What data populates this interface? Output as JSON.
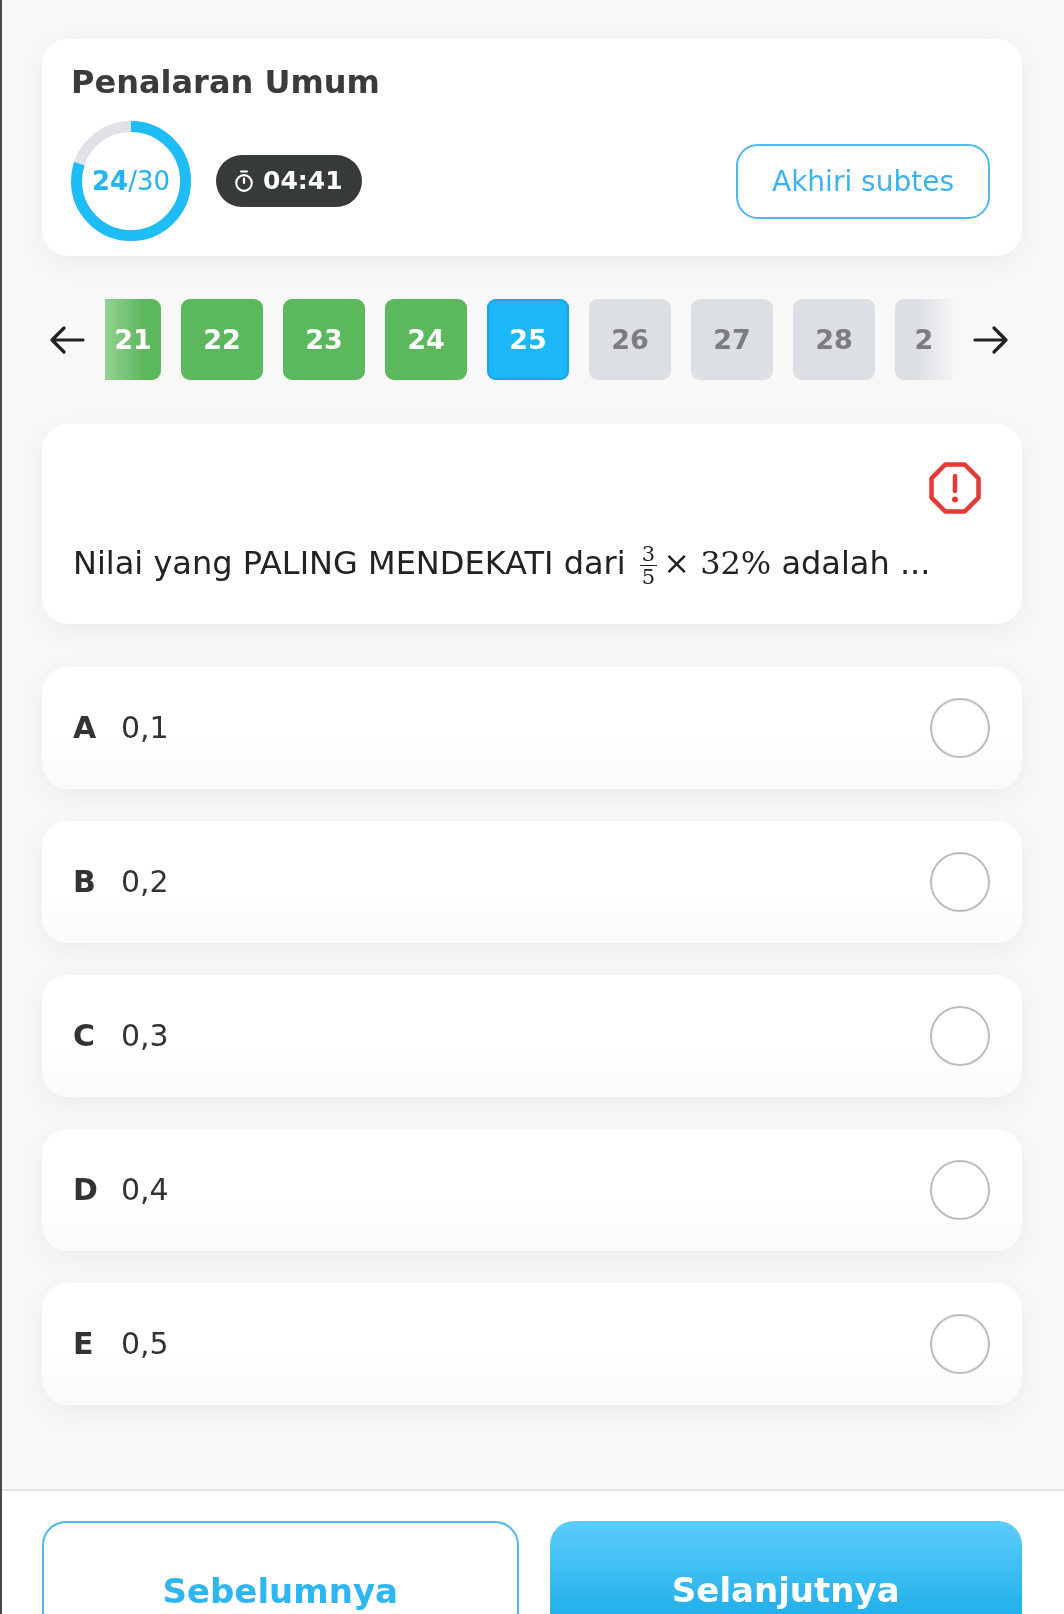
{
  "header": {
    "title": "Penalaran Umum",
    "progress": {
      "label": "**24**/30",
      "level": 0.8
    },
    "timer": "04:41",
    "end_button": "Akhiri subtes"
  },
  "question_nav": [
    {
      "label": "21",
      "answered": true,
      "selected": false
    },
    {
      "label": "22",
      "answered": true,
      "selected": false
    },
    {
      "label": "23",
      "answered": true,
      "selected": false
    },
    {
      "label": "24",
      "answered": true,
      "selected": false
    },
    {
      "label": "25",
      "answered": false,
      "selected": true
    },
    {
      "label": "26",
      "answered": false,
      "selected": false
    },
    {
      "label": "27",
      "answered": false,
      "selected": false
    },
    {
      "label": "28",
      "answered": false,
      "selected": false
    },
    {
      "label": "2",
      "answered": false,
      "selected": false
    }
  ],
  "question": {
    "text_before": "Nilai yang PALING MENDEKATI dari",
    "fraction": {
      "numerator": "3",
      "denominator": "5"
    },
    "expression": "× 32%",
    "text_after": "adalah ..."
  },
  "options": [
    {
      "letter": "A",
      "text": "0,1",
      "selected": false
    },
    {
      "letter": "B",
      "text": "0,2",
      "selected": false
    },
    {
      "letter": "C",
      "text": "0,3",
      "selected": false
    },
    {
      "letter": "D",
      "text": "0,4",
      "selected": false
    },
    {
      "letter": "E",
      "text": "0,5",
      "selected": false
    }
  ],
  "footer": {
    "previous": "Sebelumnya",
    "next": "Selanjutnya"
  }
}
